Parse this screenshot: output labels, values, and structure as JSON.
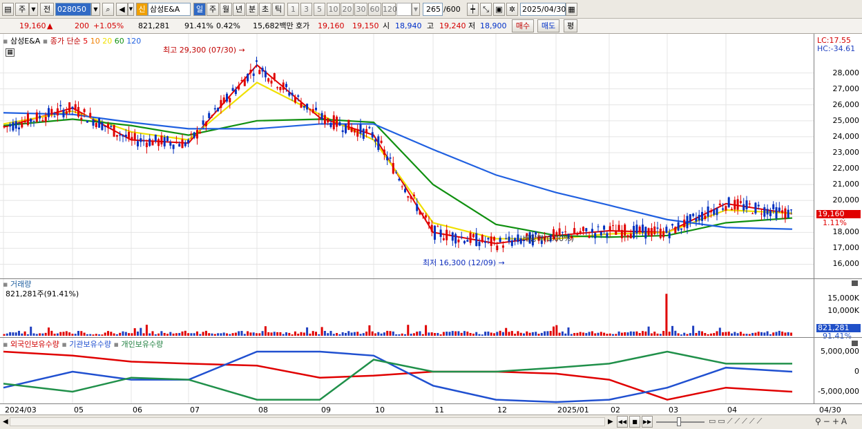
{
  "toolbar": {
    "type1": "주",
    "type2": "전",
    "code": "028050",
    "badge": "신",
    "stock_name": "삼성E&A",
    "periods": [
      "일",
      "주",
      "월",
      "년",
      "분",
      "초",
      "틱"
    ],
    "numbers": [
      "1",
      "3",
      "5",
      "10",
      "20",
      "30",
      "60",
      "120"
    ],
    "count": "265",
    "total": "/600",
    "date": "2025/04/30"
  },
  "quote": {
    "price": "19,160",
    "arrow": "▲",
    "change": "200",
    "pct": "+1.05%",
    "volume": "821,281",
    "vol_ratio": "91.41%",
    "turnover": "0.42%",
    "amount": "15,682백만",
    "ask_label": "호가",
    "ask": "19,160",
    "bid": "19,150",
    "open_label": "시",
    "open": "18,940",
    "high_label": "고",
    "high": "19,240",
    "low_label": "저",
    "low": "18,900",
    "buy": "매수",
    "sell": "매도",
    "avg": "평"
  },
  "price_panel": {
    "legend_name": "삼성E&A",
    "legend_ma": "종가 단순",
    "ma": [
      {
        "label": "5",
        "color": "#e00000"
      },
      {
        "label": "10",
        "color": "#f08000"
      },
      {
        "label": "20",
        "color": "#f0e000"
      },
      {
        "label": "60",
        "color": "#109010"
      },
      {
        "label": "120",
        "color": "#2060e0"
      }
    ],
    "hi_note": "최고 29,300 (07/30)",
    "lo_note": "최저 16,300 (12/09)",
    "div_note": "배당락(0.00%)",
    "lc": "LC:17.55",
    "hc": "HC:-34.61",
    "last_price": "19,160",
    "last_pct": "1.11%",
    "yticks": [
      "28,000",
      "27,000",
      "26,000",
      "25,000",
      "24,000",
      "23,000",
      "22,000",
      "21,000",
      "20,000",
      "19,000",
      "18,000",
      "17,000",
      "16,000"
    ]
  },
  "volume_panel": {
    "title": "거래량",
    "value": "821,281주(91.41%)",
    "yticks": [
      "15,000K",
      "10,000K"
    ],
    "last": "821,281",
    "last_pct": "91.41%"
  },
  "holder_panel": {
    "s1": "외국인보유수량",
    "s2": "기관보유수량",
    "s3": "개인보유수량",
    "yticks": [
      "5,000,000",
      "0",
      "-5,000,000"
    ]
  },
  "xaxis": {
    "labels": [
      "2024/03",
      "05",
      "06",
      "07",
      "08",
      "09",
      "10",
      "11",
      "12",
      "2025/01",
      "02",
      "03",
      "04"
    ],
    "last": "04/30"
  },
  "chart_data": {
    "type": "line",
    "x": [
      "2024/03",
      "05",
      "06",
      "07",
      "08",
      "09",
      "10",
      "11",
      "12",
      "2025/01",
      "02",
      "03",
      "04",
      "04/30"
    ],
    "series": [
      {
        "name": "5",
        "values": [
          24600,
          25800,
          23800,
          23600,
          28500,
          25200,
          24100,
          18000,
          17300,
          17800,
          18100,
          18000,
          19800,
          19160
        ]
      },
      {
        "name": "20",
        "values": [
          24800,
          25600,
          24300,
          23800,
          27400,
          25400,
          23800,
          18600,
          17600,
          17600,
          17900,
          18000,
          19400,
          19200
        ]
      },
      {
        "name": "60",
        "values": [
          24700,
          25100,
          24700,
          24100,
          25000,
          25100,
          24900,
          21000,
          18500,
          17800,
          17700,
          17800,
          18600,
          18900
        ]
      },
      {
        "name": "120",
        "values": [
          25500,
          25400,
          24900,
          24500,
          24500,
          24800,
          24800,
          23200,
          21600,
          20500,
          19700,
          18800,
          18300,
          18200
        ]
      }
    ],
    "ylim": [
      15500,
      29500
    ],
    "hi": {
      "value": 29300,
      "date": "07/30"
    },
    "lo": {
      "value": 16300,
      "date": "12/09"
    }
  },
  "status": {
    "nav_labels": [
      "◀◀",
      "■",
      "▶▶"
    ]
  }
}
